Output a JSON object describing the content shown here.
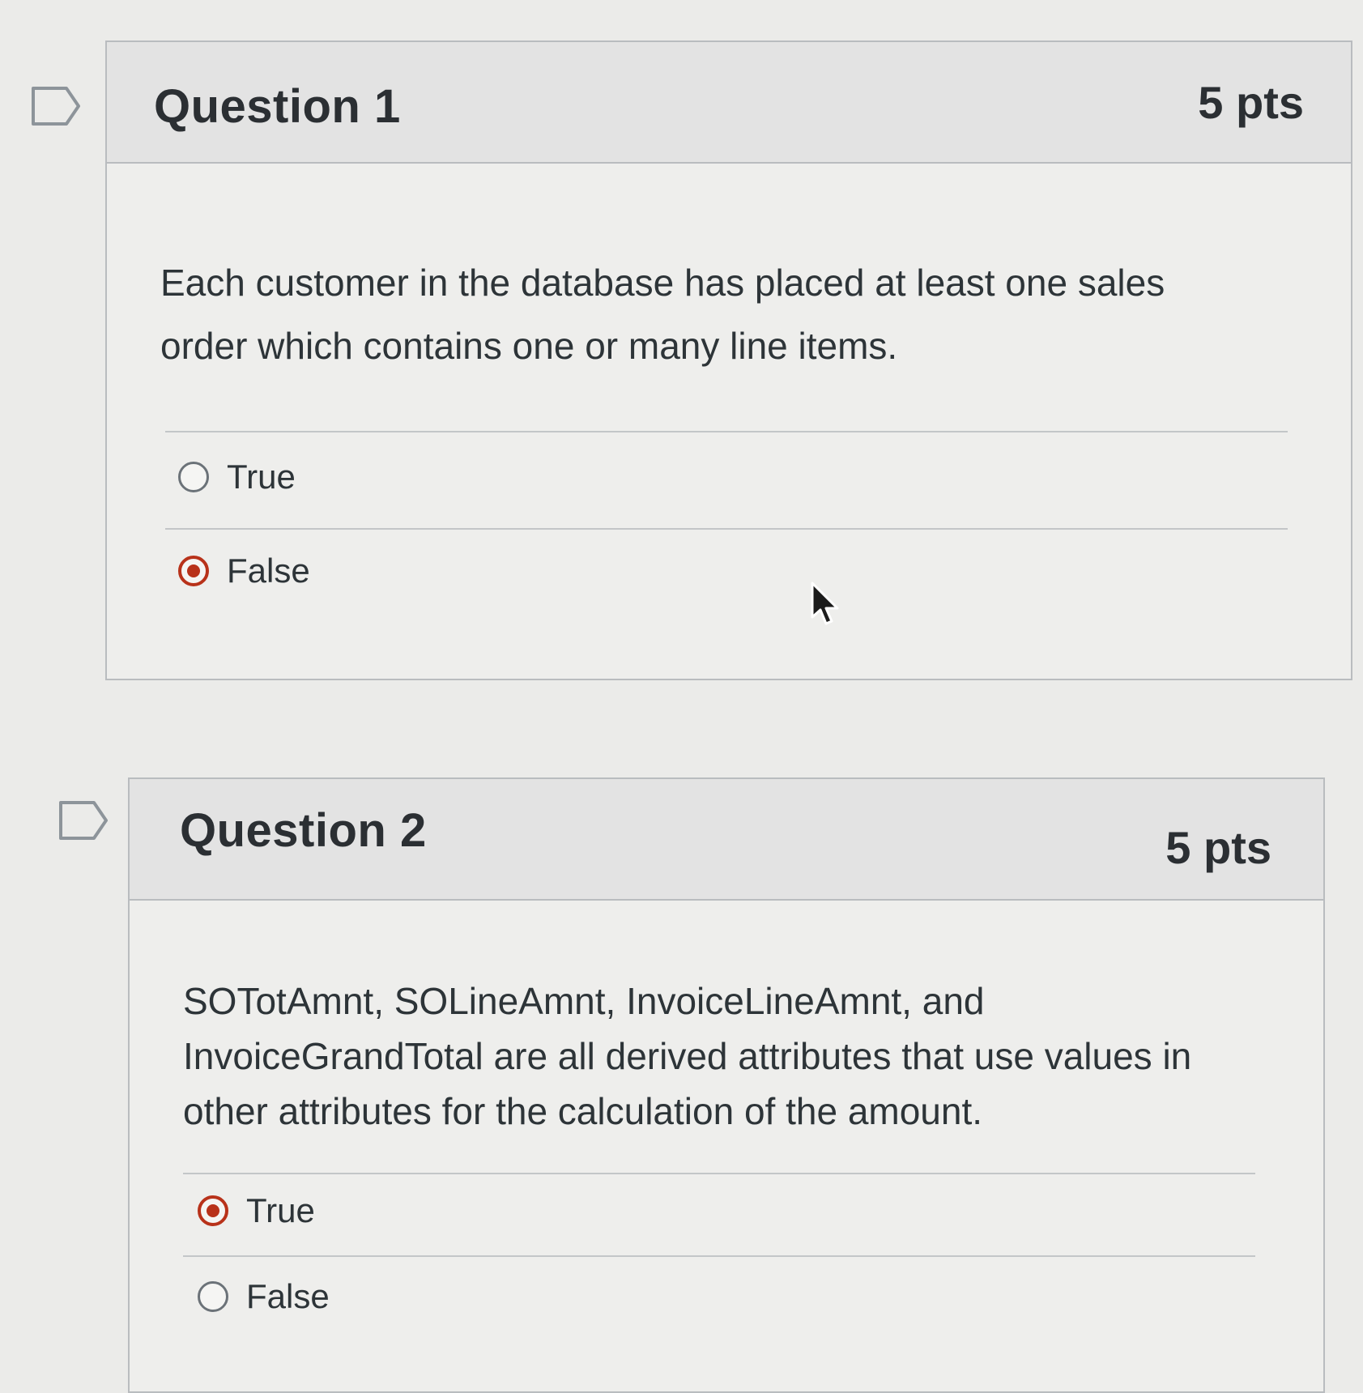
{
  "questions": [
    {
      "title": "Question 1",
      "points": "5 pts",
      "text_line1": "Each customer in the database has placed at least one sales",
      "text_line2": "order which contains one or many line items.",
      "answers": [
        {
          "label": "True",
          "selected": false
        },
        {
          "label": "False",
          "selected": true
        }
      ]
    },
    {
      "title": "Question 2",
      "points": "5 pts",
      "text_line1": "SOTotAmnt, SOLineAmnt, InvoiceLineAmnt, and",
      "text_line2": "InvoiceGrandTotal are all derived attributes that use values in",
      "text_line3": "other attributes for the calculation of the amount.",
      "answers": [
        {
          "label": "True",
          "selected": true
        },
        {
          "label": "False",
          "selected": false
        }
      ]
    }
  ],
  "colors": {
    "accent": "#b8321a",
    "header_bg": "#e3e3e3",
    "border": "#b9bcbf"
  },
  "icons": {
    "flag": "flag-question-icon",
    "radio_selected": "radio-selected-icon",
    "radio_unselected": "radio-unselected-icon",
    "cursor": "mouse-pointer-icon"
  }
}
